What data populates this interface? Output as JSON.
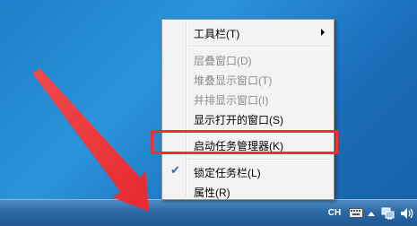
{
  "menu": {
    "toolbars_label": "工具栏(T)",
    "cascade_label": "层叠窗口(D)",
    "stacked_label": "堆叠显示窗口(T)",
    "side_by_side_label": "并排显示窗口(I)",
    "show_open_label": "显示打开的窗口(S)",
    "task_manager_label": "启动任务管理器(K)",
    "lock_taskbar_label": "锁定任务栏(L)",
    "properties_label": "属性(R)",
    "lock_checked": true
  },
  "tray": {
    "language": "CH"
  },
  "icons": {
    "check": "check-icon",
    "submenu": "submenu-arrow-icon",
    "keyboard": "keyboard-icon",
    "show_hidden": "chevron-up-icon",
    "network": "network-icon",
    "volume": "volume-icon"
  },
  "colors": {
    "highlight_box": "#ee2f34",
    "desktop_blue": "#1c7fc9",
    "taskbar_blue": "#2d6aa5"
  }
}
